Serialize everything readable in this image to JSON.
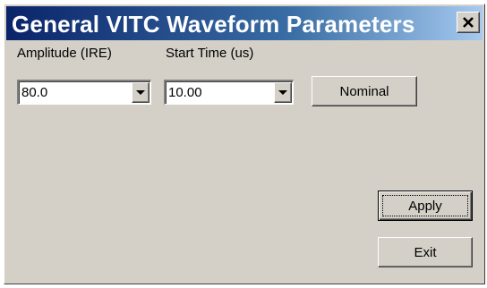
{
  "window": {
    "title": "General VITC Waveform Parameters",
    "close_symbol": "✕"
  },
  "amplitude": {
    "label": "Amplitude (IRE)",
    "value": "80.0"
  },
  "start_time": {
    "label": "Start Time (us)",
    "value": "10.00"
  },
  "buttons": {
    "nominal": "Nominal",
    "apply": "Apply",
    "exit": "Exit"
  },
  "icons": {
    "close": "close-icon",
    "dropdown": "chevron-down-icon"
  },
  "colors": {
    "titlebar_start": "#0a246a",
    "titlebar_end": "#a6caf0",
    "face": "#d4d0c8"
  }
}
